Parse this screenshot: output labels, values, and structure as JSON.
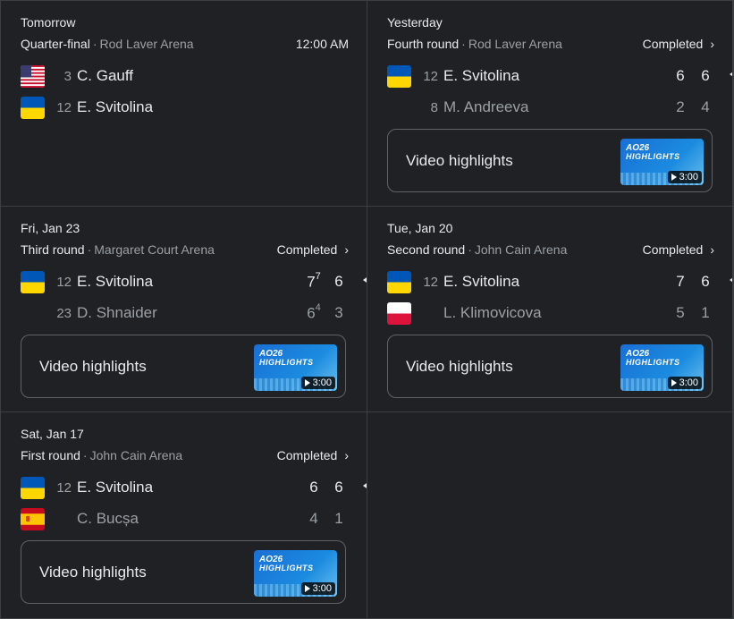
{
  "matches": [
    {
      "date": "Tomorrow",
      "round": "Quarter-final",
      "venue": "Rod Laver Arena",
      "meta": "12:00 AM",
      "p1": {
        "flag": "us",
        "seed": "3",
        "name": "C. Gauff",
        "scores": []
      },
      "p2": {
        "flag": "ua",
        "seed": "12",
        "name": "E. Svitolina",
        "scores": []
      }
    },
    {
      "date": "Yesterday",
      "round": "Fourth round",
      "venue": "Rod Laver Arena",
      "meta": "Completed",
      "p1": {
        "flag": "ua",
        "seed": "12",
        "name": "E. Svitolina",
        "scores": [
          "6",
          "6"
        ]
      },
      "p2": {
        "flag": "",
        "seed": "8",
        "name": "M. Andreeva",
        "scores": [
          "2",
          "4"
        ]
      },
      "video": {
        "label": "Video highlights",
        "logo": "AO26",
        "title": "HIGHLIGHTS",
        "duration": "3:00"
      }
    },
    {
      "date": "Fri, Jan 23",
      "round": "Third round",
      "venue": "Margaret Court Arena",
      "meta": "Completed",
      "p1": {
        "flag": "ua",
        "seed": "12",
        "name": "E. Svitolina",
        "scores": [
          "7",
          "6"
        ],
        "tb": [
          "7",
          ""
        ]
      },
      "p2": {
        "flag": "",
        "seed": "23",
        "name": "D. Shnaider",
        "scores": [
          "6",
          "3"
        ],
        "tb": [
          "4",
          ""
        ]
      },
      "video": {
        "label": "Video highlights",
        "logo": "AO26",
        "title": "HIGHLIGHTS",
        "duration": "3:00"
      }
    },
    {
      "date": "Tue, Jan 20",
      "round": "Second round",
      "venue": "John Cain Arena",
      "meta": "Completed",
      "p1": {
        "flag": "ua",
        "seed": "12",
        "name": "E. Svitolina",
        "scores": [
          "7",
          "6"
        ]
      },
      "p2": {
        "flag": "pl",
        "seed": "",
        "name": "L. Klimovicova",
        "scores": [
          "5",
          "1"
        ]
      },
      "video": {
        "label": "Video highlights",
        "logo": "AO26",
        "title": "HIGHLIGHTS",
        "duration": "3:00"
      }
    },
    {
      "date": "Sat, Jan 17",
      "round": "First round",
      "venue": "John Cain Arena",
      "meta": "Completed",
      "p1": {
        "flag": "ua",
        "seed": "12",
        "name": "E. Svitolina",
        "scores": [
          "6",
          "6"
        ]
      },
      "p2": {
        "flag": "es",
        "seed": "",
        "name": "C. Bucșa",
        "scores": [
          "4",
          "1"
        ]
      },
      "video": {
        "label": "Video highlights",
        "logo": "AO26",
        "title": "HIGHLIGHTS",
        "duration": "3:00"
      }
    }
  ],
  "colors": {
    "background": "#202124",
    "divider": "#3c4043",
    "text": "#e8eaed",
    "muted": "#9aa0a6"
  }
}
